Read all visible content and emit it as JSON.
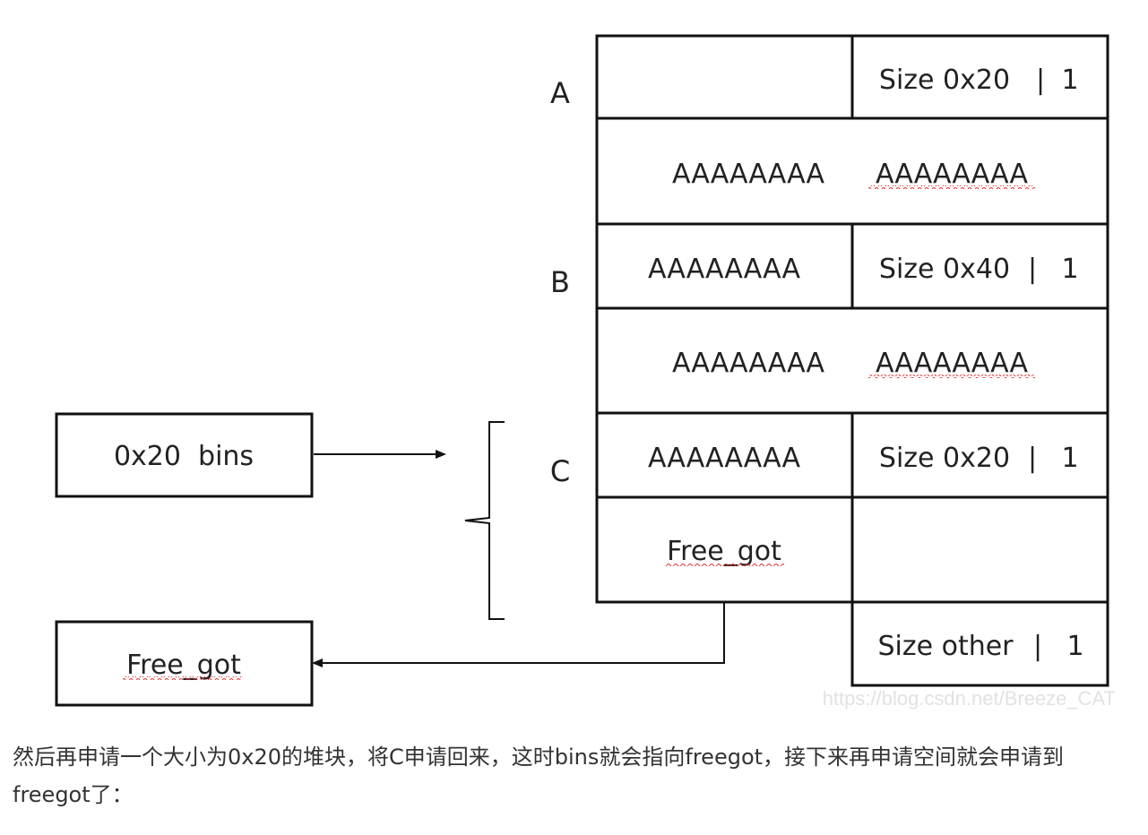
{
  "diagram": {
    "chunk_labels": [
      "A",
      "B",
      "C"
    ],
    "chunk_a": {
      "size_field": "Size 0x20",
      "sep": "|",
      "flag": "1",
      "data_left": "AAAAAAAA",
      "data_right": "AAAAAAAA"
    },
    "chunk_b": {
      "prev_data": "AAAAAAAA",
      "size_field": "Size 0x40",
      "sep": "|",
      "flag": "1",
      "data_left": "AAAAAAAA",
      "data_right": "AAAAAAAA"
    },
    "chunk_c": {
      "prev_data": "AAAAAAAA",
      "size_field": "Size 0x20",
      "sep": "|",
      "flag": "1",
      "fd": "Free_got"
    },
    "next_chunk": {
      "size_field": "Size other",
      "sep": "|",
      "flag": "1"
    },
    "bins_box": "0x20  bins",
    "target_box": "Free_got",
    "watermark": "https://blog.csdn.net/Breeze_CAT",
    "colors": {
      "stroke": "#111111",
      "text": "#222222",
      "squiggle": "#e03030",
      "watermark": "#e2e2e2"
    }
  },
  "caption": "然后再申请一个大小为0x20的堆块，将C申请回来，这时bins就会指向freegot，接下来再申请空间就会申请到freegot了："
}
